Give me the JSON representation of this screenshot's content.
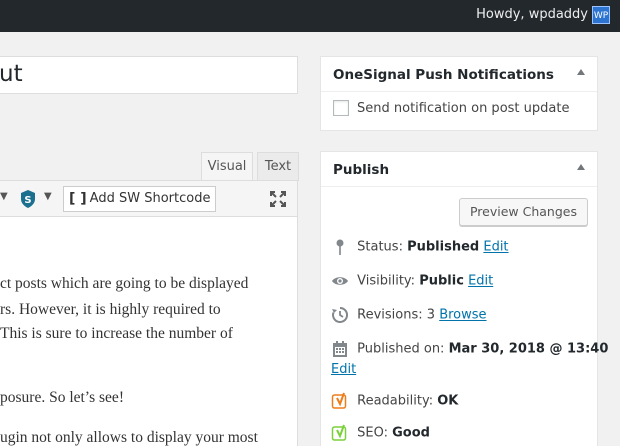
{
  "adminbar": {
    "howdy": "Howdy, wpdaddy",
    "avatar": "WP"
  },
  "title": {
    "value": "ut"
  },
  "editor_tabs": {
    "visual": "Visual",
    "text": "Text"
  },
  "toolbar": {
    "shortcode_label": "Add SW Shortcode",
    "icons": [
      "caret-down",
      "shield-s-icon",
      "caret-down",
      "bracket-icon",
      "fullscreen-icon"
    ]
  },
  "content": {
    "lines": [
      "ct posts which are going to be displayed",
      "rs. However, it is highly required to",
      "This is sure to increase the number of",
      "posure. So let’s see!",
      "ugin not only allows to display your most"
    ]
  },
  "onesignal": {
    "title": "OneSignal Push Notifications",
    "checkbox_label": "Send notification on post update",
    "checked": false
  },
  "publish": {
    "title": "Publish",
    "preview_label": "Preview Changes",
    "status_label": "Status:",
    "status_value": "Published",
    "status_edit": "Edit",
    "visibility_label": "Visibility:",
    "visibility_value": "Public",
    "visibility_edit": "Edit",
    "revisions_label": "Revisions:",
    "revisions_value": "3",
    "revisions_link": "Browse",
    "published_label": "Published on:",
    "published_value": "Mar 30, 2018 @ 13:40",
    "published_edit": "Edit",
    "readability_label": "Readability:",
    "readability_value": "OK",
    "seo_label": "SEO:",
    "seo_value": "Good"
  },
  "colors": {
    "adminbar": "#23282d",
    "link": "#0073aa",
    "yoast_ok": "#ee7c1b",
    "yoast_good": "#7ad03a"
  }
}
